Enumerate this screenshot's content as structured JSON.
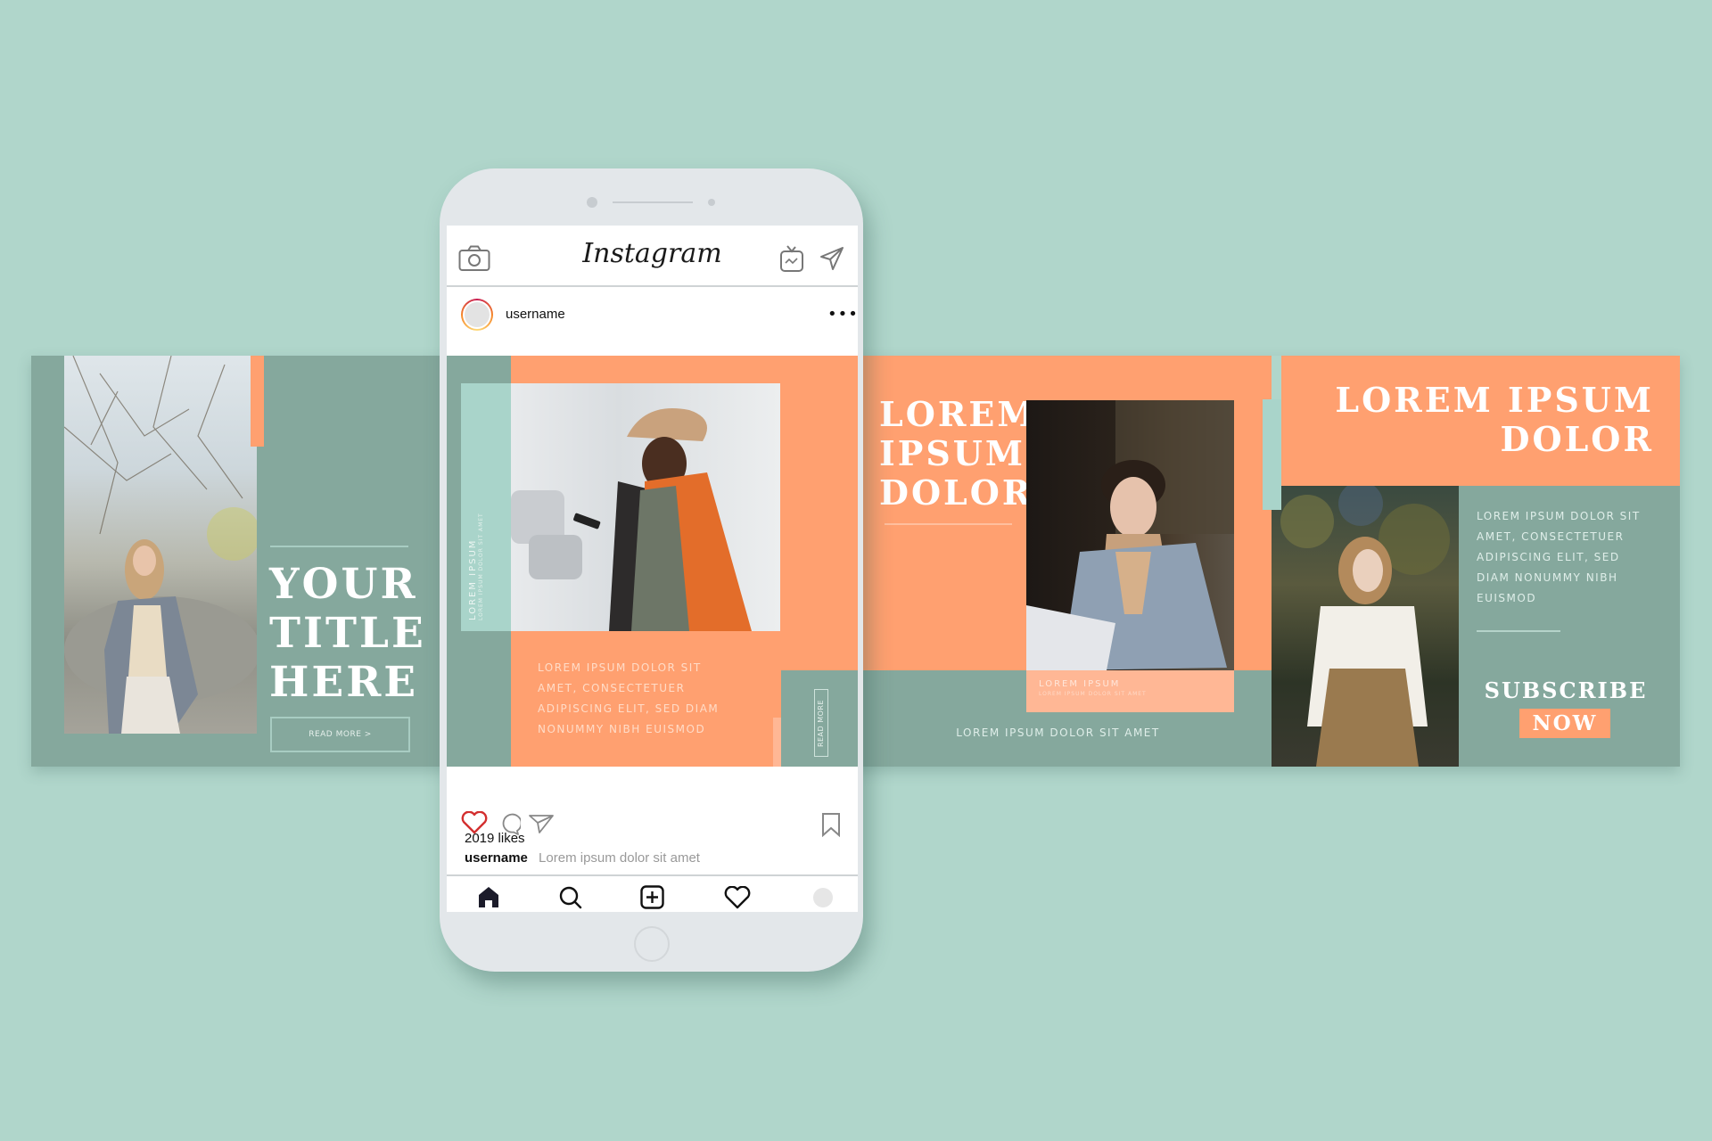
{
  "colors": {
    "background": "#B0D6CB",
    "teal": "#85A89D",
    "orange": "#FFA070",
    "peach": "#FFB795",
    "mint": "#A9D4CA",
    "like_red": "#D32F2F"
  },
  "left_post": {
    "photo_alt": "woman in grey coat among rocks and trees",
    "title_lines": [
      "YOUR",
      "TITLE",
      "HERE"
    ],
    "read_more": "READ MORE >"
  },
  "phone": {
    "app_title": "Instagram",
    "header_icons": [
      "camera-icon",
      "igtv-icon",
      "direct-message-icon"
    ],
    "post": {
      "username": "username",
      "more_icon": "more-options-icon",
      "side_label_title": "LOREM IPSUM",
      "side_label_sub": "LOREM IPSUM DOLOR SIT AMET",
      "photo_alt": "smiling man in hat and orange coat holding phone",
      "body_lines": [
        "LOREM IPSUM DOLOR SIT",
        "AMET, CONSECTETUER",
        "ADIPISCING ELIT, SED DIAM",
        "NONUMMY NIBH EUISMOD"
      ],
      "read_more": "READ MORE"
    },
    "actions": [
      "like-icon",
      "comment-icon",
      "share-icon",
      "bookmark-icon"
    ],
    "likes": "2019 likes",
    "caption_user": "username",
    "caption_text": "Lorem ipsum dolor sit amet",
    "nav": [
      "home-icon",
      "search-icon",
      "new-post-icon",
      "activity-icon",
      "profile-icon"
    ]
  },
  "right_post_1": {
    "title_lines": [
      "LOREM",
      "IPSUM",
      "DOLOR"
    ],
    "photo_alt": "young man in blue coat sitting by a doorway",
    "caption_title": "LOREM IPSUM",
    "caption_sub": "LOREM IPSUM DOLOR SIT AMET",
    "subtitle": "LOREM IPSUM DOLOR SIT AMET"
  },
  "right_post_2": {
    "title_lines": [
      "LOREM IPSUM",
      "DOLOR"
    ],
    "photo_alt": "woman in white blouse and tan trousers under a tree",
    "body_lines": [
      "LOREM IPSUM DOLOR SIT",
      "AMET, CONSECTETUER",
      "ADIPISCING ELIT, SED",
      "DIAM NONUMMY NIBH",
      "EUISMOD"
    ],
    "cta_top": "SUBSCRIBE",
    "cta_bottom": "NOW"
  }
}
